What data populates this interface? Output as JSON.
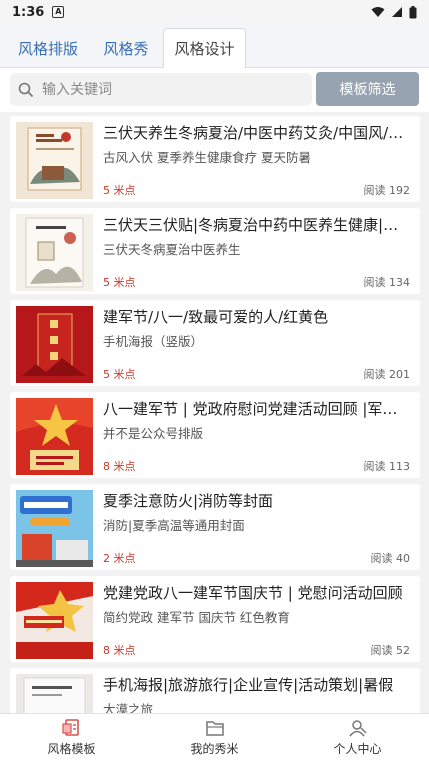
{
  "status": {
    "time": "1:36",
    "notification_badge": "A"
  },
  "tabs": [
    {
      "label": "风格排版",
      "active": false
    },
    {
      "label": "风格秀",
      "active": false
    },
    {
      "label": "风格设计",
      "active": true
    }
  ],
  "search": {
    "placeholder": "输入关键词",
    "filter_label": "模板筛选"
  },
  "items": [
    {
      "title": "三伏天养生冬病夏治/中医中药艾灸/中国风/节日",
      "subtitle": "古风入伏 夏季养生健康食疗 夏天防暑",
      "points": "5 米点",
      "reads": "阅读 192",
      "thumb_text": "三伏天养生冬病夏治"
    },
    {
      "title": "三伏天三伏贴|冬病夏治中药中医养生健康|中国风",
      "subtitle": "三伏天冬病夏治中医养生",
      "points": "5 米点",
      "reads": "阅读 134",
      "thumb_text": "三伏天养"
    },
    {
      "title": "建军节/八一/致最可爱的人/红黄色",
      "subtitle": "手机海报（竖版）",
      "points": "5 米点",
      "reads": "阅读 201",
      "thumb_text": "建军节"
    },
    {
      "title": "八一建军节 | 党政府慰问党建活动回顾 |军旅风",
      "subtitle": "并不是公众号排版",
      "points": "8 米点",
      "reads": "阅读 113",
      "thumb_text": "八一"
    },
    {
      "title": "夏季注意防火|消防等封面",
      "subtitle": "消防|夏季高温等通用封面",
      "points": "2 米点",
      "reads": "阅读 40",
      "thumb_text": "夏季高温"
    },
    {
      "title": "党建党政八一建军节国庆节 | 党慰问活动回顾",
      "subtitle": "简约党政 建军节 国庆节 红色教育",
      "points": "8 米点",
      "reads": "阅读 52",
      "thumb_text": "德扶北京 满怀红色教育"
    },
    {
      "title": "手机海报|旅游旅行|企业宣传|活动策划|暑假",
      "subtitle": "大漠之旅",
      "points": "",
      "reads": "",
      "thumb_text": ""
    }
  ],
  "nav": [
    {
      "label": "风格模板",
      "icon": "template-icon"
    },
    {
      "label": "我的秀米",
      "icon": "folder-icon"
    },
    {
      "label": "个人中心",
      "icon": "user-icon"
    }
  ]
}
